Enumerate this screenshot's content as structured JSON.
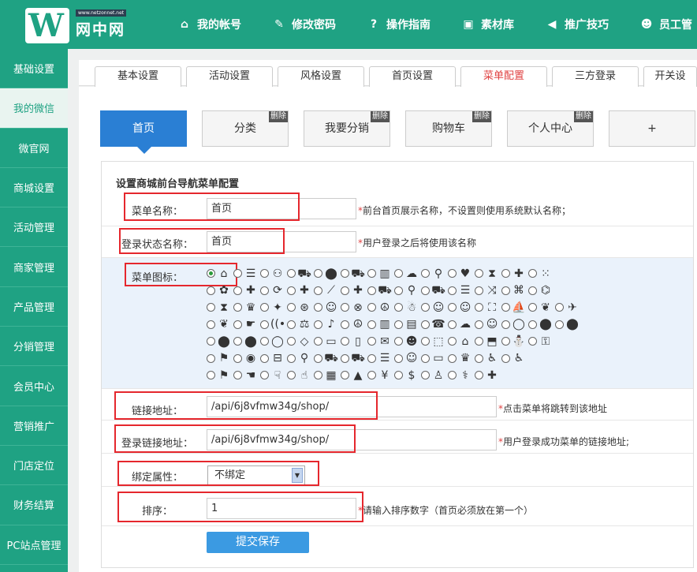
{
  "brand": {
    "name": "网中网",
    "url": "www.netzonnet.net",
    "mark": "W"
  },
  "nav": [
    {
      "label": "我的帐号",
      "icon": "home-icon"
    },
    {
      "label": "修改密码",
      "icon": "edit-icon"
    },
    {
      "label": "操作指南",
      "icon": "help-icon"
    },
    {
      "label": "素材库",
      "icon": "image-icon"
    },
    {
      "label": "推广技巧",
      "icon": "bullhorn-icon"
    },
    {
      "label": "员工管",
      "icon": "users-icon"
    }
  ],
  "sidebar": [
    "基础设置",
    "我的微信",
    "微官网",
    "商城设置",
    "活动管理",
    "商家管理",
    "产品管理",
    "分销管理",
    "会员中心",
    "营销推广",
    "门店定位",
    "财务结算",
    "PC站点管理"
  ],
  "tabs": [
    "基本设置",
    "活动设置",
    "风格设置",
    "首页设置",
    "菜单配置",
    "三方登录",
    "开关设"
  ],
  "menu_tabs": [
    {
      "label": "首页",
      "del": ""
    },
    {
      "label": "分类",
      "del": "删除"
    },
    {
      "label": "我要分销",
      "del": "删除"
    },
    {
      "label": "购物车",
      "del": "删除"
    },
    {
      "label": "个人中心",
      "del": "删除"
    },
    {
      "label": "+",
      "del": ""
    }
  ],
  "form": {
    "title": "设置商城前台导航菜单配置",
    "name_label": "菜单名称：",
    "name_value": "首页",
    "name_hint": "前台首页展示名称，不设置则使用系统默认名称；",
    "login_name_label": "登录状态名称：",
    "login_name_value": "首页",
    "login_name_hint": "用户登录之后将使用该名称",
    "icon_label": "菜单图标：",
    "link_label": "链接地址：",
    "link_value": "/api/6j8vfmw34g/shop/",
    "link_hint": "点击菜单将跳转到该地址",
    "login_link_label": "登录链接地址：",
    "login_link_value": "/api/6j8vfmw34g/shop/",
    "login_link_hint": "用户登录成功菜单的链接地址;",
    "bind_label": "绑定属性：",
    "bind_value": "不绑定",
    "sort_label": "排序：",
    "sort_value": "1",
    "sort_hint": "请输入排序数字（首页必须放在第一个）",
    "submit": "提交保存",
    "required_mark": "*"
  },
  "icon_rows": [
    [
      "⌂",
      "☰",
      "⚇",
      "⛟",
      "⬤",
      "⛟",
      "▥",
      "☁",
      "⚲",
      "♥",
      "⧗",
      "✚",
      "⁙"
    ],
    [
      "✿",
      "✚",
      "⟳",
      "✚",
      "⟋",
      "✚",
      "⛟",
      "⚲",
      "⛟",
      "☰",
      "⤨",
      "⌘",
      "⌬"
    ],
    [
      "⧗",
      "♛",
      "✦",
      "⊛",
      "☺",
      "⊗",
      "☮",
      "☃",
      "☺",
      "☺",
      "⛶",
      "⛵",
      "❦",
      "✈"
    ],
    [
      "❦",
      "☛",
      "((•",
      "⚖",
      "♪",
      "☮",
      "▥",
      "▤",
      "☎",
      "☁",
      "☺",
      "◯",
      "⬤",
      "⬤"
    ],
    [
      "⬤",
      "⬤",
      "◯",
      "◇",
      "▭",
      "▯",
      "✉",
      "☻",
      "⬚",
      "⌂",
      "⬒",
      "⛄",
      "⚿"
    ],
    [
      "⚑",
      "◉",
      "⊟",
      "⚲",
      "⛟",
      "⛟",
      "☰",
      "☺",
      "▭",
      "♛",
      "♿",
      "♿"
    ],
    [
      "⚑",
      "☚",
      "☟",
      "☝",
      "▦",
      "▲",
      "¥",
      "$",
      "♙",
      "⚕",
      "✚"
    ]
  ]
}
